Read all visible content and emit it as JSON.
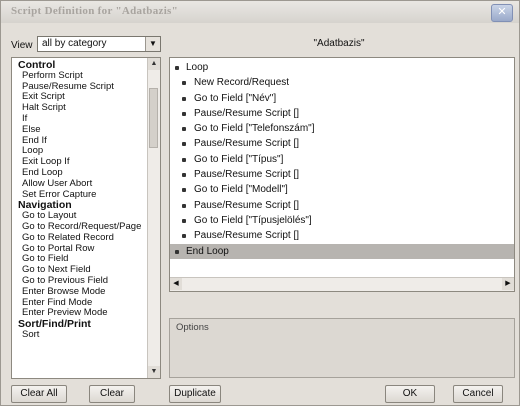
{
  "window": {
    "title": "Script Definition for \"Adatbazis\"",
    "close_symbol": "✕"
  },
  "view": {
    "label": "View",
    "selected": "all by category"
  },
  "script_name": "\"Adatbazis\"",
  "step_categories": [
    {
      "type": "header",
      "label": "Control"
    },
    {
      "type": "item",
      "label": "Perform Script"
    },
    {
      "type": "item",
      "label": "Pause/Resume Script"
    },
    {
      "type": "item",
      "label": "Exit Script"
    },
    {
      "type": "item",
      "label": "Halt Script"
    },
    {
      "type": "item",
      "label": "If"
    },
    {
      "type": "item",
      "label": "Else"
    },
    {
      "type": "item",
      "label": "End If"
    },
    {
      "type": "item",
      "label": "Loop"
    },
    {
      "type": "item",
      "label": "Exit Loop If"
    },
    {
      "type": "item",
      "label": "End Loop"
    },
    {
      "type": "item",
      "label": "Allow User Abort"
    },
    {
      "type": "item",
      "label": "Set Error Capture"
    },
    {
      "type": "header",
      "label": "Navigation"
    },
    {
      "type": "item",
      "label": "Go to Layout"
    },
    {
      "type": "item",
      "label": "Go to Record/Request/Page"
    },
    {
      "type": "item",
      "label": "Go to Related Record"
    },
    {
      "type": "item",
      "label": "Go to Portal Row"
    },
    {
      "type": "item",
      "label": "Go to Field"
    },
    {
      "type": "item",
      "label": "Go to Next Field"
    },
    {
      "type": "item",
      "label": "Go to Previous Field"
    },
    {
      "type": "item",
      "label": "Enter Browse Mode"
    },
    {
      "type": "item",
      "label": "Enter Find Mode"
    },
    {
      "type": "item",
      "label": "Enter Preview Mode"
    },
    {
      "type": "header",
      "label": "Sort/Find/Print"
    },
    {
      "type": "item",
      "label": "Sort"
    }
  ],
  "script_steps": [
    {
      "label": "Loop",
      "indent": false,
      "selected": false
    },
    {
      "label": "New Record/Request",
      "indent": true,
      "selected": false
    },
    {
      "label": "Go to Field [\"Név\"]",
      "indent": true,
      "selected": false
    },
    {
      "label": "Pause/Resume Script []",
      "indent": true,
      "selected": false
    },
    {
      "label": "Go to Field [\"Telefonszám\"]",
      "indent": true,
      "selected": false
    },
    {
      "label": "Pause/Resume Script []",
      "indent": true,
      "selected": false
    },
    {
      "label": "Go to Field [\"Típus\"]",
      "indent": true,
      "selected": false
    },
    {
      "label": "Pause/Resume Script []",
      "indent": true,
      "selected": false
    },
    {
      "label": "Go to Field [\"Modell\"]",
      "indent": true,
      "selected": false
    },
    {
      "label": "Pause/Resume Script []",
      "indent": true,
      "selected": false
    },
    {
      "label": "Go to Field [\"Típusjelölés\"]",
      "indent": true,
      "selected": false
    },
    {
      "label": "Pause/Resume Script []",
      "indent": true,
      "selected": false
    },
    {
      "label": "End Loop",
      "indent": false,
      "selected": true
    }
  ],
  "options_label": "Options",
  "buttons": {
    "clear_all": "Clear All",
    "clear": "Clear",
    "duplicate": "Duplicate",
    "ok": "OK",
    "cancel": "Cancel"
  },
  "icons": {
    "select_arrow": "▼",
    "scroll_up": "▲",
    "scroll_down": "▼",
    "scroll_left": "◀",
    "scroll_right": "▶"
  }
}
